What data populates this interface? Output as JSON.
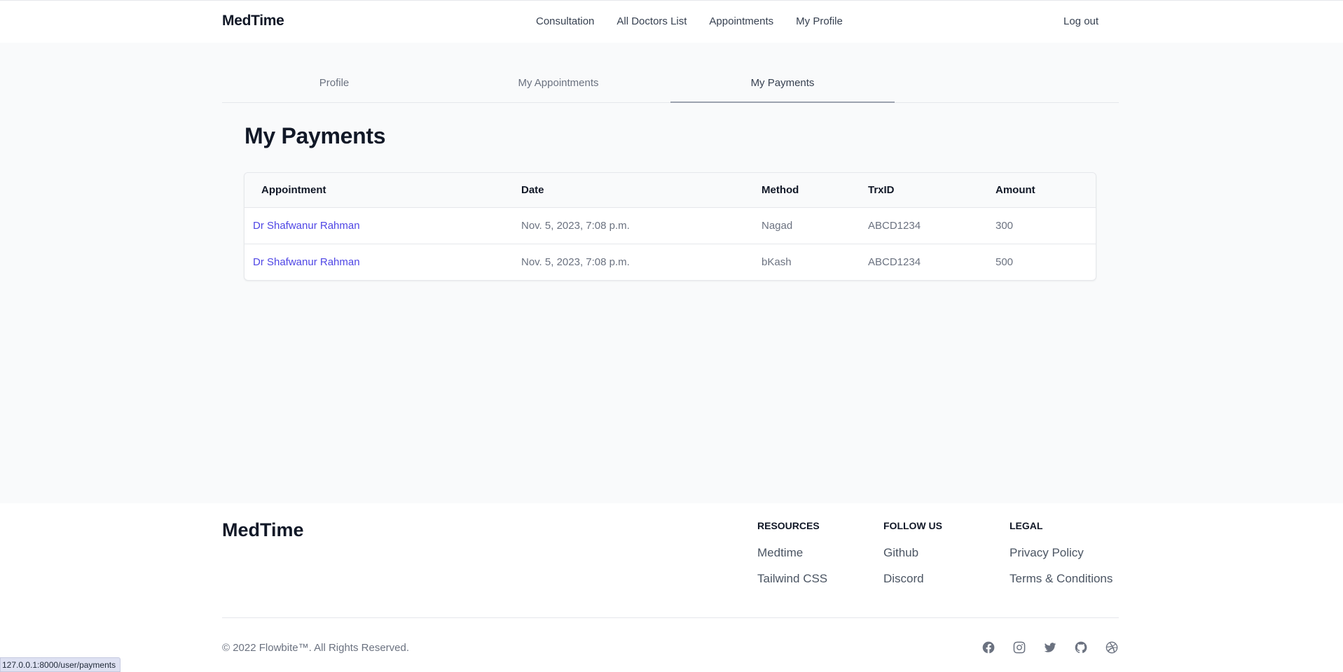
{
  "header": {
    "brand": "MedTime",
    "nav": [
      "Consultation",
      "All Doctors List",
      "Appointments",
      "My Profile"
    ],
    "logout": "Log out"
  },
  "tabs": [
    {
      "label": "Profile",
      "active": false
    },
    {
      "label": "My Appointments",
      "active": false
    },
    {
      "label": "My Payments",
      "active": true
    }
  ],
  "main": {
    "title": "My Payments",
    "table": {
      "columns": [
        "Appointment",
        "Date",
        "Method",
        "TrxID",
        "Amount"
      ],
      "rows": [
        [
          "Dr Shafwanur Rahman",
          "Nov. 5, 2023, 7:08 p.m.",
          "Nagad",
          "ABCD1234",
          "300"
        ],
        [
          "Dr Shafwanur Rahman",
          "Nov. 5, 2023, 7:08 p.m.",
          "bKash",
          "ABCD1234",
          "500"
        ]
      ]
    }
  },
  "footer": {
    "brand": "MedTime",
    "columns": [
      {
        "heading": "RESOURCES",
        "links": [
          "Medtime",
          "Tailwind CSS"
        ]
      },
      {
        "heading": "FOLLOW US",
        "links": [
          "Github",
          "Discord"
        ]
      },
      {
        "heading": "LEGAL",
        "links": [
          "Privacy Policy",
          "Terms & Conditions"
        ]
      }
    ],
    "copyright": "© 2022 Flowbite™. All Rights Reserved.",
    "socials": [
      "facebook-icon",
      "instagram-icon",
      "twitter-icon",
      "github-icon",
      "dribbble-icon"
    ]
  },
  "status_bar": {
    "url": "127.0.0.1:8000/user/payments"
  },
  "colors": {
    "link": "#4f46e5",
    "background": "#f9fafb",
    "text": "#111827"
  }
}
